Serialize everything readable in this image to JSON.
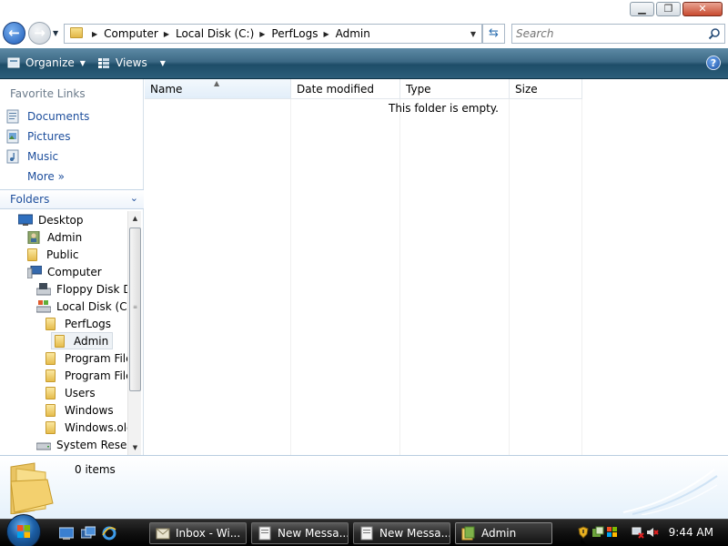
{
  "window": {
    "minimize_glyph": "▁",
    "maximize_glyph": "❐",
    "close_glyph": "✕"
  },
  "address": {
    "back_glyph": "←",
    "forward_glyph": "→",
    "crumbs": [
      "Computer",
      "Local Disk (C:)",
      "PerfLogs",
      "Admin"
    ],
    "refresh_glyph": "⇆"
  },
  "search": {
    "placeholder": "Search"
  },
  "commands": {
    "organize": "Organize",
    "views": "Views",
    "help": "?"
  },
  "favorites": {
    "heading": "Favorite Links",
    "items": [
      {
        "label": "Documents",
        "icon": "documents-icon"
      },
      {
        "label": "Pictures",
        "icon": "pictures-icon"
      },
      {
        "label": "Music",
        "icon": "music-icon"
      },
      {
        "label": "More  »",
        "icon": ""
      }
    ]
  },
  "folders": {
    "heading": "Folders",
    "chevron": "⌄",
    "tree": [
      {
        "label": "Desktop",
        "icon": "desktop-icon"
      },
      {
        "label": "Admin",
        "icon": "user-folder-icon"
      },
      {
        "label": "Public",
        "icon": "folder-icon"
      },
      {
        "label": "Computer",
        "icon": "computer-icon"
      },
      {
        "label": "Floppy Disk Dr",
        "icon": "floppy-drive-icon"
      },
      {
        "label": "Local Disk (C:)",
        "icon": "local-disk-icon"
      },
      {
        "label": "PerfLogs",
        "icon": "folder-icon"
      },
      {
        "label": "Admin",
        "icon": "folder-icon",
        "selected": true
      },
      {
        "label": "Program File",
        "icon": "folder-icon"
      },
      {
        "label": "Program File",
        "icon": "folder-icon"
      },
      {
        "label": "Users",
        "icon": "folder-icon"
      },
      {
        "label": "Windows",
        "icon": "folder-icon"
      },
      {
        "label": "Windows.olc",
        "icon": "folder-icon"
      },
      {
        "label": "System Reserv",
        "icon": "drive-icon"
      }
    ]
  },
  "columns": {
    "name": "Name",
    "date_modified": "Date modified",
    "type": "Type",
    "size": "Size"
  },
  "content": {
    "empty_message": "This folder is empty."
  },
  "details": {
    "item_count": "0 items"
  },
  "taskbar": {
    "buttons": [
      {
        "label": "Inbox - Wi...",
        "icon": "mail-icon"
      },
      {
        "label": "New Messa...",
        "icon": "message-icon"
      },
      {
        "label": "New Messa...",
        "icon": "message-icon"
      },
      {
        "label": "Admin",
        "icon": "folder-icon",
        "active": true
      }
    ],
    "clock": "9:44 AM"
  }
}
